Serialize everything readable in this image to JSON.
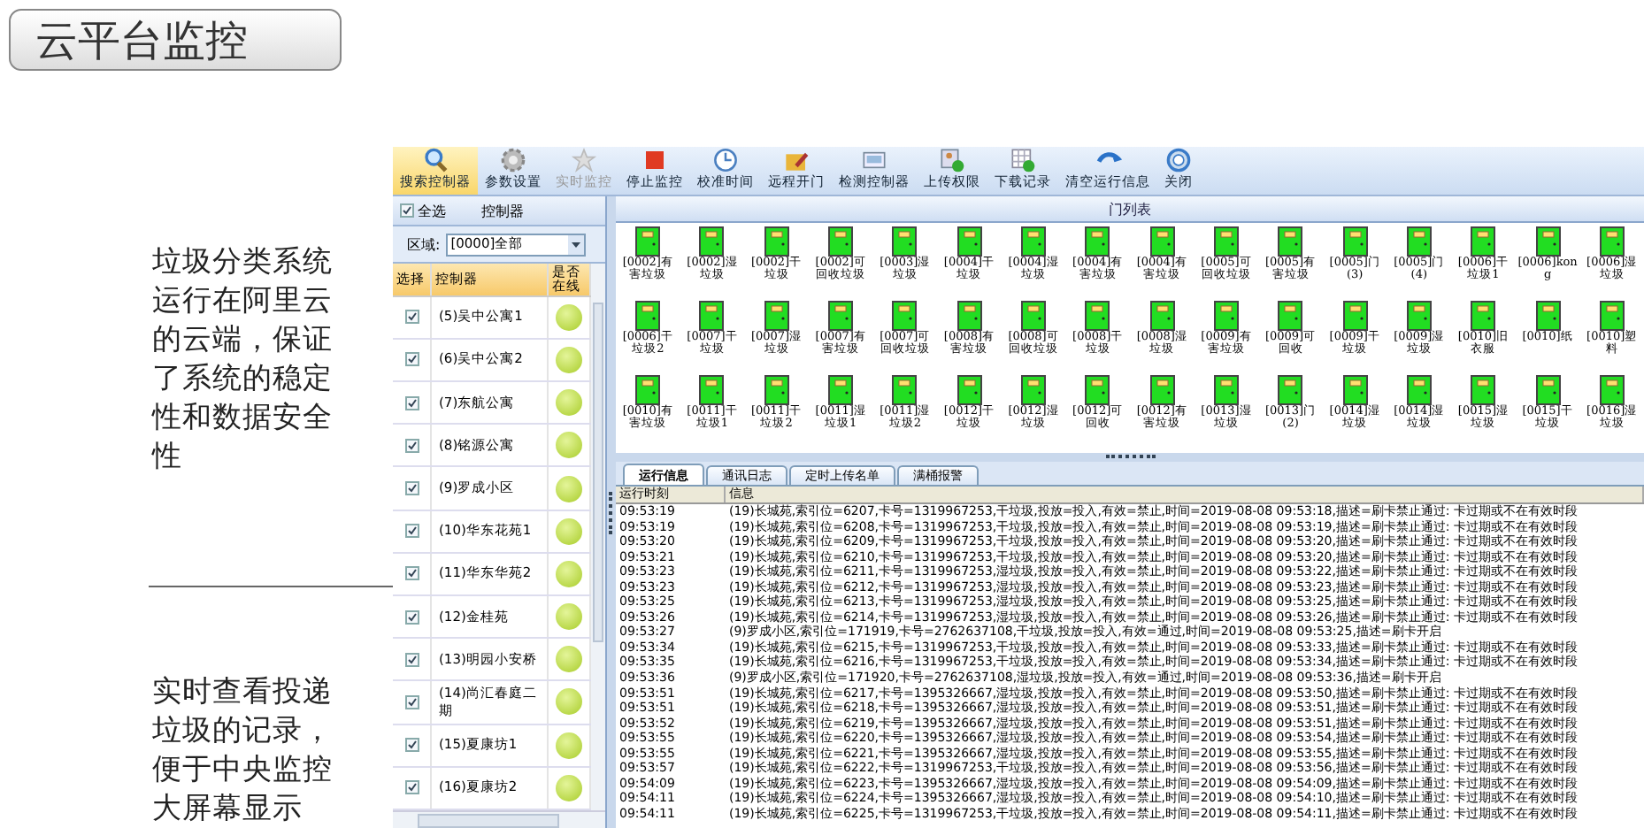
{
  "title": "云平台监控",
  "notes": [
    {
      "text": "垃圾分类系统运行在阿里云的云端，保证了系统的稳定性和数据安全性"
    },
    {
      "text": "实时查看投递垃圾的记录，便于中央监控大屏幕显示"
    }
  ],
  "toolbar": [
    {
      "label": "搜索控制器",
      "selected": true,
      "disabled": false
    },
    {
      "label": "参数设置",
      "selected": false,
      "disabled": false
    },
    {
      "label": "实时监控",
      "selected": false,
      "disabled": true
    },
    {
      "label": "停止监控",
      "selected": false,
      "disabled": false
    },
    {
      "label": "校准时间",
      "selected": false,
      "disabled": false
    },
    {
      "label": "远程开门",
      "selected": false,
      "disabled": false
    },
    {
      "label": "检测控制器",
      "selected": false,
      "disabled": false
    },
    {
      "label": "上传权限",
      "selected": false,
      "disabled": false
    },
    {
      "label": "下载记录",
      "selected": false,
      "disabled": false
    },
    {
      "label": "清空运行信息",
      "selected": false,
      "disabled": false
    },
    {
      "label": "关闭",
      "selected": false,
      "disabled": false
    }
  ],
  "controller_panel": {
    "select_all": {
      "label": "全选",
      "checked": true
    },
    "title": "控制器",
    "region": {
      "label": "区域:",
      "value": "[0000]全部"
    },
    "columns": [
      "选择",
      "控制器",
      "是否在线"
    ],
    "rows": [
      {
        "name": "(5)吴中公寓1",
        "checked": true,
        "online": true
      },
      {
        "name": "(6)吴中公寓2",
        "checked": true,
        "online": true
      },
      {
        "name": "(7)东航公寓",
        "checked": true,
        "online": true
      },
      {
        "name": "(8)铭源公寓",
        "checked": true,
        "online": true
      },
      {
        "name": "(9)罗成小区",
        "checked": true,
        "online": true
      },
      {
        "name": "(10)华东花苑1",
        "checked": true,
        "online": true
      },
      {
        "name": "(11)华东华苑2",
        "checked": true,
        "online": true
      },
      {
        "name": "(12)金桂苑",
        "checked": true,
        "online": true
      },
      {
        "name": "(13)明园小安桥",
        "checked": true,
        "online": true
      },
      {
        "name": "(14)尚汇春庭二期",
        "checked": true,
        "online": true
      },
      {
        "name": "(15)夏康坊1",
        "checked": true,
        "online": true
      },
      {
        "name": "(16)夏康坊2",
        "checked": true,
        "online": true
      }
    ]
  },
  "door_list": {
    "title": "门列表",
    "doors": [
      "[0002]有害垃圾",
      "[0002]湿垃圾",
      "[0002]干垃圾",
      "[0002]可回收垃圾",
      "[0003]湿垃圾",
      "[0004]干垃圾",
      "[0004]湿垃圾",
      "[0004]有害垃圾",
      "[0004]有害垃圾",
      "[0005]可回收垃圾",
      "[0005]有害垃圾",
      "[0005]门(3)",
      "[0005]门(4)",
      "[0006]干垃圾1",
      "[0006]kong",
      "[0006]湿垃圾",
      "[0006]干垃圾2",
      "[0007]干垃圾",
      "[0007]湿垃圾",
      "[0007]有害垃圾",
      "[0007]可回收垃圾",
      "[0008]有害垃圾",
      "[0008]可回收垃圾",
      "[0008]干垃圾",
      "[0008]湿垃圾",
      "[0009]有害垃圾",
      "[0009]可回收",
      "[0009]干垃圾",
      "[0009]湿垃圾",
      "[0010]旧衣服",
      "[0010]纸",
      "[0010]塑料",
      "[0010]有害垃圾",
      "[0011]干垃圾1",
      "[0011]干垃圾2",
      "[0011]湿垃圾1",
      "[0011]湿垃圾2",
      "[0012]干垃圾",
      "[0012]湿垃圾",
      "[0012]可回收",
      "[0012]有害垃圾",
      "[0013]湿垃圾",
      "[0013]门(2)",
      "[0014]湿垃圾",
      "[0014]湿垃圾",
      "[0015]湿垃圾",
      "[0015]干垃圾",
      "[0016]湿垃圾"
    ]
  },
  "tabs": [
    {
      "label": "运行信息",
      "selected": true
    },
    {
      "label": "通讯日志",
      "selected": false
    },
    {
      "label": "定时上传名单",
      "selected": false
    },
    {
      "label": "满桶报警",
      "selected": false
    }
  ],
  "log": {
    "columns": [
      "运行时刻",
      "信息"
    ],
    "rows": [
      {
        "time": "09:53:19",
        "info": "(19)长城苑,索引位=6207,卡号=1319967253,干垃圾,投放=投入,有效=禁止,时间=2019-08-08 09:53:18,描述=刷卡禁止通过: 卡过期或不在有效时段"
      },
      {
        "time": "09:53:19",
        "info": "(19)长城苑,索引位=6208,卡号=1319967253,干垃圾,投放=投入,有效=禁止,时间=2019-08-08 09:53:19,描述=刷卡禁止通过: 卡过期或不在有效时段"
      },
      {
        "time": "09:53:20",
        "info": "(19)长城苑,索引位=6209,卡号=1319967253,干垃圾,投放=投入,有效=禁止,时间=2019-08-08 09:53:20,描述=刷卡禁止通过: 卡过期或不在有效时段"
      },
      {
        "time": "09:53:21",
        "info": "(19)长城苑,索引位=6210,卡号=1319967253,干垃圾,投放=投入,有效=禁止,时间=2019-08-08 09:53:20,描述=刷卡禁止通过: 卡过期或不在有效时段"
      },
      {
        "time": "09:53:23",
        "info": "(19)长城苑,索引位=6211,卡号=1319967253,湿垃圾,投放=投入,有效=禁止,时间=2019-08-08 09:53:22,描述=刷卡禁止通过: 卡过期或不在有效时段"
      },
      {
        "time": "09:53:23",
        "info": "(19)长城苑,索引位=6212,卡号=1319967253,湿垃圾,投放=投入,有效=禁止,时间=2019-08-08 09:53:23,描述=刷卡禁止通过: 卡过期或不在有效时段"
      },
      {
        "time": "09:53:25",
        "info": "(19)长城苑,索引位=6213,卡号=1319967253,湿垃圾,投放=投入,有效=禁止,时间=2019-08-08 09:53:25,描述=刷卡禁止通过: 卡过期或不在有效时段"
      },
      {
        "time": "09:53:26",
        "info": "(19)长城苑,索引位=6214,卡号=1319967253,湿垃圾,投放=投入,有效=禁止,时间=2019-08-08 09:53:26,描述=刷卡禁止通过: 卡过期或不在有效时段"
      },
      {
        "time": "09:53:27",
        "info": "(9)罗成小区,索引位=171919,卡号=2762637108,干垃圾,投放=投入,有效=通过,时间=2019-08-08 09:53:25,描述=刷卡开启"
      },
      {
        "time": "09:53:34",
        "info": "(19)长城苑,索引位=6215,卡号=1319967253,干垃圾,投放=投入,有效=禁止,时间=2019-08-08 09:53:33,描述=刷卡禁止通过: 卡过期或不在有效时段"
      },
      {
        "time": "09:53:35",
        "info": "(19)长城苑,索引位=6216,卡号=1319967253,干垃圾,投放=投入,有效=禁止,时间=2019-08-08 09:53:34,描述=刷卡禁止通过: 卡过期或不在有效时段"
      },
      {
        "time": "09:53:36",
        "info": "(9)罗成小区,索引位=171920,卡号=2762637108,湿垃圾,投放=投入,有效=通过,时间=2019-08-08 09:53:36,描述=刷卡开启"
      },
      {
        "time": "09:53:51",
        "info": "(19)长城苑,索引位=6217,卡号=1395326667,湿垃圾,投放=投入,有效=禁止,时间=2019-08-08 09:53:50,描述=刷卡禁止通过: 卡过期或不在有效时段"
      },
      {
        "time": "09:53:51",
        "info": "(19)长城苑,索引位=6218,卡号=1395326667,湿垃圾,投放=投入,有效=禁止,时间=2019-08-08 09:53:51,描述=刷卡禁止通过: 卡过期或不在有效时段"
      },
      {
        "time": "09:53:52",
        "info": "(19)长城苑,索引位=6219,卡号=1395326667,湿垃圾,投放=投入,有效=禁止,时间=2019-08-08 09:53:51,描述=刷卡禁止通过: 卡过期或不在有效时段"
      },
      {
        "time": "09:53:55",
        "info": "(19)长城苑,索引位=6220,卡号=1395326667,湿垃圾,投放=投入,有效=禁止,时间=2019-08-08 09:53:54,描述=刷卡禁止通过: 卡过期或不在有效时段"
      },
      {
        "time": "09:53:55",
        "info": "(19)长城苑,索引位=6221,卡号=1395326667,湿垃圾,投放=投入,有效=禁止,时间=2019-08-08 09:53:55,描述=刷卡禁止通过: 卡过期或不在有效时段"
      },
      {
        "time": "09:53:57",
        "info": "(19)长城苑,索引位=6222,卡号=1319967253,干垃圾,投放=投入,有效=禁止,时间=2019-08-08 09:53:56,描述=刷卡禁止通过: 卡过期或不在有效时段"
      },
      {
        "time": "09:54:09",
        "info": "(19)长城苑,索引位=6223,卡号=1395326667,湿垃圾,投放=投入,有效=禁止,时间=2019-08-08 09:54:09,描述=刷卡禁止通过: 卡过期或不在有效时段"
      },
      {
        "time": "09:54:11",
        "info": "(19)长城苑,索引位=6224,卡号=1395326667,湿垃圾,投放=投入,有效=禁止,时间=2019-08-08 09:54:10,描述=刷卡禁止通过: 卡过期或不在有效时段"
      },
      {
        "time": "09:54:11",
        "info": "(19)长城苑,索引位=6225,卡号=1319967253,干垃圾,投放=投入,有效=禁止,时间=2019-08-08 09:54:11,描述=刷卡禁止通过: 卡过期或不在有效时段"
      }
    ]
  }
}
